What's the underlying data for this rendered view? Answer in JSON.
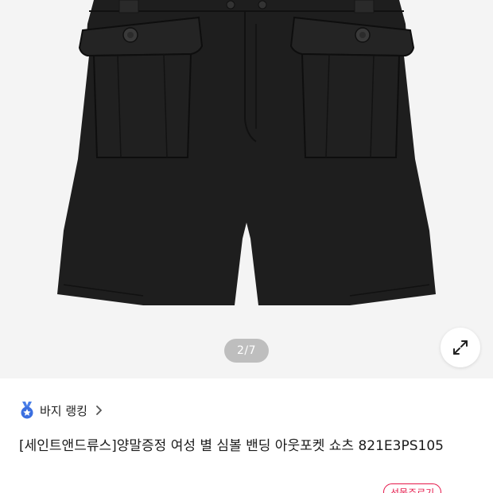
{
  "gallery": {
    "indicator": "2/7",
    "expand_icon": "expand-arrows-icon",
    "colors": {
      "background": "#f4f4f4",
      "garment": "#1e1e1e"
    }
  },
  "ranking": {
    "icon": "medal-star-icon",
    "label": "바지 랭킹",
    "chevron_icon": "chevron-right-icon"
  },
  "product": {
    "title": "[세인트앤드류스]양말증정 여성 별 심볼 밴딩 아웃포켓 쇼츠 821E3PS105"
  },
  "badge": {
    "label": "선물주르기",
    "color": "#e5174a"
  }
}
